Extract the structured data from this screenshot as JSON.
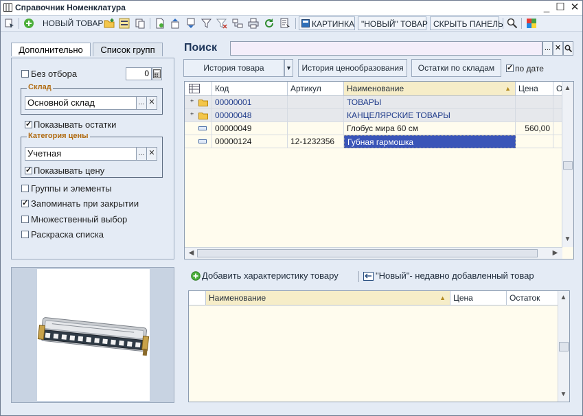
{
  "window": {
    "title": "Справочник Номенклатура",
    "controls": [
      "_",
      "☐",
      "✕"
    ]
  },
  "toolbar": {
    "new_item": "НОВЫЙ ТОВАР",
    "picture": "КАРТИНКА",
    "new_quoted": "\"НОВЫЙ\" ТОВАР",
    "hide_panel": "СКРЫТЬ ПАНЕЛЬ"
  },
  "left_tabs": [
    "Дополнительно",
    "Список групп"
  ],
  "filters": {
    "no_filter_label": "Без отбора",
    "no_filter_checked": false,
    "no_filter_value": "0",
    "warehouse_group": "Склад",
    "warehouse_value": "Основной склад",
    "show_remains_label": "Показывать остатки",
    "show_remains_checked": true,
    "price_category_group": "Категория цены",
    "price_category_value": "Учетная",
    "show_price_label": "Показывать цену",
    "show_price_checked": true,
    "groups_elements_label": "Группы и элементы",
    "groups_elements_checked": false,
    "remember_label": "Запоминать при закрытии",
    "remember_checked": true,
    "multi_select_label": "Множественный выбор",
    "multi_select_checked": false,
    "coloring_label": "Раскраска списка",
    "coloring_checked": false
  },
  "search": {
    "label": "Поиск",
    "value": ""
  },
  "actions": {
    "history": "История товара",
    "pricing_history": "История ценообразования",
    "warehouse_remains": "Остатки по складам",
    "by_date_label": "по дате",
    "by_date_checked": true
  },
  "grid": {
    "columns": [
      "Код",
      "Артикул",
      "Наименование",
      "Цена",
      "О"
    ],
    "rows": [
      {
        "type": "group",
        "code": "00000001",
        "article": "",
        "name": "ТОВАРЫ",
        "price": ""
      },
      {
        "type": "group",
        "code": "00000048",
        "article": "",
        "name": "КАНЦЕЛЯРСКИЕ ТОВАРЫ",
        "price": ""
      },
      {
        "type": "item",
        "code": "00000049",
        "article": "",
        "name": "Глобус мира 60 см",
        "price": "560,00"
      },
      {
        "type": "item",
        "code": "00000124",
        "article": "12-1232356",
        "name": "Губная гармошка",
        "price": ""
      }
    ]
  },
  "links": {
    "add_characteristic": "Добавить характеристику товару",
    "new_recent": "\"Новый\"- недавно добавленный товар"
  },
  "grid2": {
    "columns": [
      "Наименование",
      "Цена",
      "Остаток"
    ]
  }
}
